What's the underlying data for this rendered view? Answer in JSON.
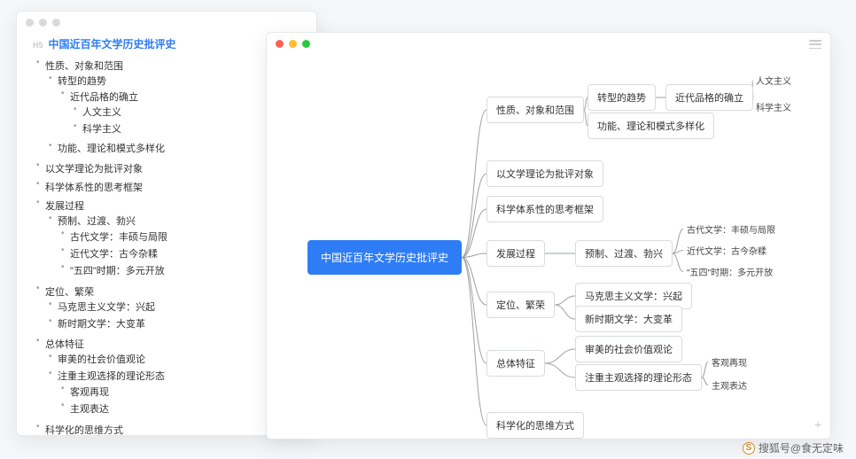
{
  "root": "中国近百年文学历史批评史",
  "h5_label": "H5",
  "watermark": "搜狐号@食无定味",
  "watermark_icon": "S",
  "level1": [
    {
      "label": "性质、对象和范围",
      "children": [
        {
          "label": "转型的趋势",
          "children": [
            {
              "label": "近代品格的确立",
              "children": [
                {
                  "label": "人文主义"
                },
                {
                  "label": "科学主义"
                }
              ]
            }
          ]
        },
        {
          "label": "功能、理论和模式多样化"
        }
      ]
    },
    {
      "label": "以文学理论为批评对象"
    },
    {
      "label": "科学体系性的思考框架"
    },
    {
      "label": "发展过程",
      "children": [
        {
          "label": "预制、过渡、勃兴",
          "children": [
            {
              "label": "古代文学：丰硕与局限"
            },
            {
              "label": "近代文学：古今杂糅"
            },
            {
              "label": "\"五四\"时期：多元开放"
            }
          ]
        }
      ]
    },
    {
      "label": "定位、繁荣",
      "children": [
        {
          "label": "马克思主义文学：兴起"
        },
        {
          "label": "新时期文学：大变革"
        }
      ]
    },
    {
      "label": "总体特征",
      "children": [
        {
          "label": "审美的社会价值观论"
        },
        {
          "label": "注重主观选择的理论形态",
          "children": [
            {
              "label": "客观再现"
            },
            {
              "label": "主观表达"
            }
          ]
        }
      ]
    },
    {
      "label": "科学化的思维方式"
    }
  ]
}
